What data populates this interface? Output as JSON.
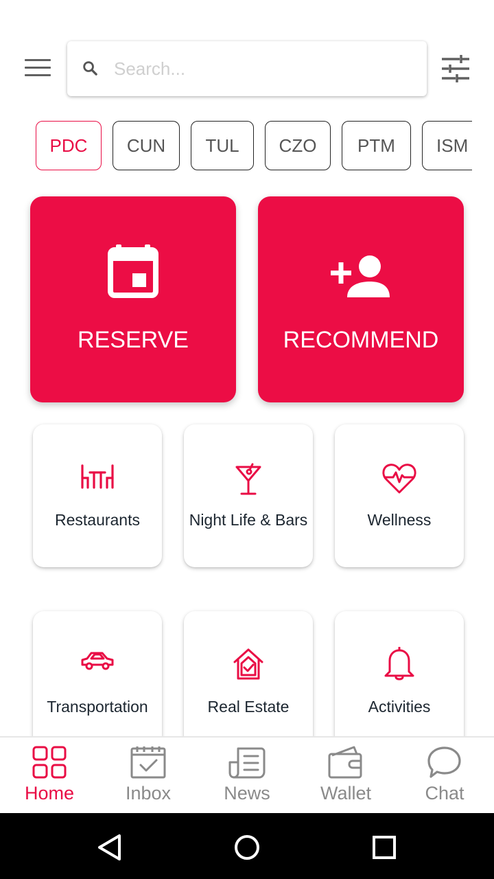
{
  "search": {
    "placeholder": "Search..."
  },
  "chips": [
    {
      "label": "PDC",
      "active": true
    },
    {
      "label": "CUN",
      "active": false
    },
    {
      "label": "TUL",
      "active": false
    },
    {
      "label": "CZO",
      "active": false
    },
    {
      "label": "PTM",
      "active": false
    },
    {
      "label": "ISM",
      "active": false
    }
  ],
  "actions": {
    "reserve": {
      "label": "RESERVE",
      "icon": "calendar-icon"
    },
    "recommend": {
      "label": "RECOMMEND",
      "icon": "person-add-icon"
    }
  },
  "categories": [
    {
      "label": "Restaurants",
      "icon": "restaurant-table-icon"
    },
    {
      "label": "Night Life & Bars",
      "icon": "cocktail-icon"
    },
    {
      "label": "Wellness",
      "icon": "heartbeat-icon"
    },
    {
      "label": "Transportation",
      "icon": "car-icon"
    },
    {
      "label": "Real Estate",
      "icon": "house-check-icon"
    },
    {
      "label": "Activities",
      "icon": "bell-icon"
    }
  ],
  "bottom_nav": [
    {
      "label": "Home",
      "icon": "grid-icon",
      "active": true
    },
    {
      "label": "Inbox",
      "icon": "calendar-check-icon",
      "active": false
    },
    {
      "label": "News",
      "icon": "newspaper-icon",
      "active": false
    },
    {
      "label": "Wallet",
      "icon": "wallet-icon",
      "active": false
    },
    {
      "label": "Chat",
      "icon": "chat-bubble-icon",
      "active": false
    }
  ],
  "colors": {
    "accent": "#ec0d45",
    "inactive": "#8a8a8a",
    "text": "#1c2630"
  }
}
